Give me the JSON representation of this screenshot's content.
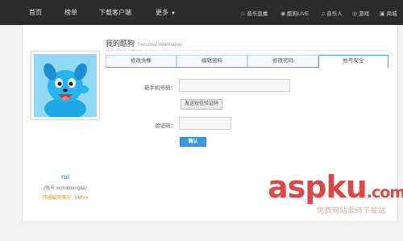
{
  "topnav": {
    "items": [
      "首页",
      "榜单",
      "下载客户端",
      "更多"
    ],
    "right_items": [
      {
        "icon": "star-icon",
        "glyph": "☆",
        "label": "音乐直播"
      },
      {
        "icon": "live-icon",
        "glyph": "◉",
        "label": "酷狗LIVE"
      },
      {
        "icon": "headphones-icon",
        "glyph": "♫",
        "label": "音乐人"
      },
      {
        "icon": "gamepad-icon",
        "glyph": "◎",
        "label": "游戏"
      },
      {
        "icon": "shop-icon",
        "glyph": "▣",
        "label": "商城"
      }
    ]
  },
  "profile": {
    "username": "rui",
    "account": "(帐号:worulmengaa)",
    "vip_text": "开通酷狗豪华",
    "vip_tag": "VIP>>"
  },
  "section": {
    "title": "我的酷狗",
    "subtitle": "Personal information"
  },
  "tabs": [
    {
      "label": "修改头像",
      "active": false
    },
    {
      "label": "编辑资料",
      "active": false
    },
    {
      "label": "修改密码",
      "active": false
    },
    {
      "label": "帐号安全",
      "active": true
    }
  ],
  "form": {
    "phone_label": "新手机号码：",
    "phone_value": "",
    "send_code_label": "发送短信验证码",
    "code_label": "验证码：",
    "code_value": "",
    "confirm_label": "确认"
  },
  "watermark": {
    "logo_asp": "asp",
    "logo_ku": "ku",
    "logo_dot": ".com",
    "sub": "免费网站源码下载站"
  },
  "colors": {
    "topbar": "#2b2b2b",
    "accent_blue": "#3a9ae0",
    "vip_orange": "#e8a317",
    "watermark_red": "#d63a3a"
  }
}
